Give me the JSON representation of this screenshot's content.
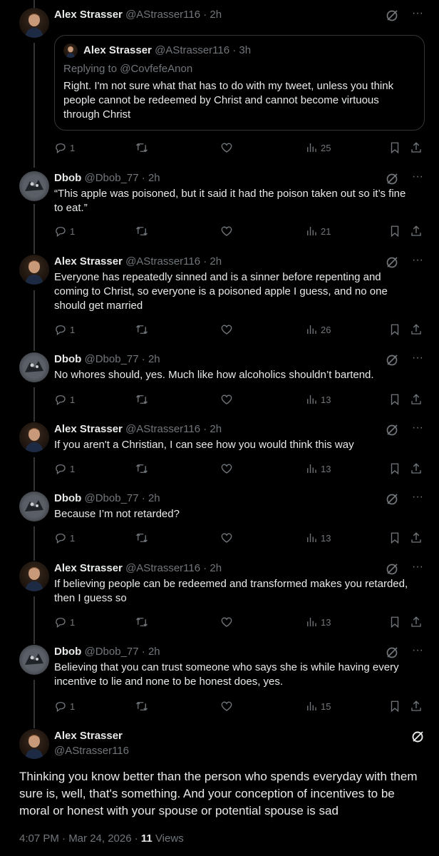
{
  "colors": {
    "background": "#000000",
    "text": "#e7e9ea",
    "muted": "#71767b",
    "border": "#333639"
  },
  "quote": {
    "name": "Alex Strasser",
    "handle": "@AStrasser116",
    "separator": "·",
    "time": "3h",
    "replying_to": "Replying to @CovfefeAnon",
    "text": "Right. I'm not sure what that has to do with my tweet, unless you think people cannot be redeemed by Christ and cannot become virtuous through Christ"
  },
  "tweets": [
    {
      "name": "Alex Strasser",
      "handle": "@AStrasser116",
      "separator": "·",
      "time": "2h",
      "text": "",
      "replies": "1",
      "views": "25"
    },
    {
      "name": "Dbob",
      "handle": "@Dbob_77",
      "separator": "·",
      "time": "2h",
      "text": "“This apple was poisoned, but it said it had the poison taken out so it’s fine to eat.”",
      "replies": "1",
      "views": "21"
    },
    {
      "name": "Alex Strasser",
      "handle": "@AStrasser116",
      "separator": "·",
      "time": "2h",
      "text": "Everyone has repeatedly sinned and is a sinner before repenting and coming to Christ, so everyone is a poisoned apple I guess, and no one should get married",
      "replies": "1",
      "views": "26"
    },
    {
      "name": "Dbob",
      "handle": "@Dbob_77",
      "separator": "·",
      "time": "2h",
      "text": "No whores should, yes. Much like how alcoholics shouldn’t bartend.",
      "replies": "1",
      "views": "13"
    },
    {
      "name": "Alex Strasser",
      "handle": "@AStrasser116",
      "separator": "·",
      "time": "2h",
      "text": "If you aren't a Christian, I can see how you would think this way",
      "replies": "1",
      "views": "13"
    },
    {
      "name": "Dbob",
      "handle": "@Dbob_77",
      "separator": "·",
      "time": "2h",
      "text": "Because I’m not retarded?",
      "replies": "1",
      "views": "13"
    },
    {
      "name": "Alex Strasser",
      "handle": "@AStrasser116",
      "separator": "·",
      "time": "2h",
      "text": "If believing people can be redeemed and transformed makes you retarded, then I guess so",
      "replies": "1",
      "views": "13"
    },
    {
      "name": "Dbob",
      "handle": "@Dbob_77",
      "separator": "·",
      "time": "2h",
      "text": "Believing that you can trust someone who says she is while having every incentive to lie and none to be honest does, yes.",
      "replies": "1",
      "views": "15"
    }
  ],
  "main": {
    "name": "Alex Strasser",
    "handle": "@AStrasser116",
    "text": "Thinking you know better than the person who spends everyday with them sure is, well, that's something. And your conception of incentives to be moral or honest with your spouse or potential spouse is sad",
    "timestamp": "4:07 PM · Mar 24, 2026 · ",
    "views_count": "11",
    "views_label": " Views"
  },
  "icons": {
    "more": "···",
    "grok": "grok-icon",
    "reply": "reply-icon",
    "retweet": "retweet-icon",
    "like": "like-icon",
    "views": "views-icon",
    "bookmark": "bookmark-icon",
    "share": "share-icon"
  }
}
